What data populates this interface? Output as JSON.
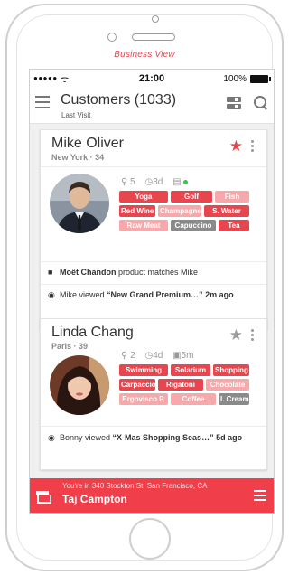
{
  "frame": {
    "caption": "Business View"
  },
  "status_bar": {
    "signal": "●●●●●",
    "wifi": "ᯤ",
    "time": "21:00",
    "battery_pct": "100%"
  },
  "header": {
    "title": "Customers (1033)",
    "subtitle": "Last Visit"
  },
  "cards": [
    {
      "name": "Mike Oliver",
      "meta": "New York · 34",
      "starred": true,
      "stats": {
        "visits": "5",
        "last": "3d",
        "extra": ""
      },
      "tags": [
        [
          {
            "label": "Yoga",
            "style": "strong"
          },
          {
            "label": "Golf",
            "style": "strong"
          },
          {
            "label": "Fish",
            "style": "light"
          }
        ],
        [
          {
            "label": "Red Wine",
            "style": "strong"
          },
          {
            "label": "Champagne",
            "style": "light"
          },
          {
            "label": "S. Water",
            "style": "strong"
          }
        ],
        [
          {
            "label": "Raw Meat",
            "style": "light"
          },
          {
            "label": "Capuccino",
            "style": "gray"
          },
          {
            "label": "Tea",
            "style": "strong"
          }
        ]
      ],
      "notes": [
        {
          "icon": "bag-icon",
          "bold_prefix": "Moët Chandon",
          "text": " product matches Mike",
          "bold_mid": "",
          "suffix": ""
        },
        {
          "icon": "eye-icon",
          "bold_prefix": "",
          "text": "Mike viewed ",
          "bold_mid": "“New Grand Premium…”",
          "suffix": " 2m ago"
        }
      ]
    },
    {
      "name": "Linda Chang",
      "meta": "Paris · 39",
      "starred": false,
      "stats": {
        "visits": "2",
        "last": "4d",
        "extra": "5m"
      },
      "tags": [
        [
          {
            "label": "Swimming",
            "style": "strong"
          },
          {
            "label": "Solarium",
            "style": "strong"
          },
          {
            "label": "Shopping",
            "style": "strong"
          }
        ],
        [
          {
            "label": "Carpaccio",
            "style": "strong"
          },
          {
            "label": "Rigatoni",
            "style": "strong"
          },
          {
            "label": "Chocolate",
            "style": "light"
          }
        ],
        [
          {
            "label": "Ergovisco P.",
            "style": "light"
          },
          {
            "label": "Coffee",
            "style": "light"
          },
          {
            "label": "I. Cream",
            "style": "gray"
          }
        ]
      ],
      "notes": [
        {
          "icon": "eye-icon",
          "bold_prefix": "",
          "text": "Bonny viewed ",
          "bold_mid": "“X-Mas Shopping Seas…”",
          "suffix": " 5d ago"
        }
      ]
    }
  ],
  "bottom_bar": {
    "location_line": "You're in 340 Stockton St, San Francisco, CA",
    "location_name": "Taj Campton"
  },
  "colors": {
    "accent": "#e8464e",
    "accent_light": "#f6a8ab",
    "bottom_bar": "#f03e4a",
    "gray_tag": "#8a8a8a"
  }
}
